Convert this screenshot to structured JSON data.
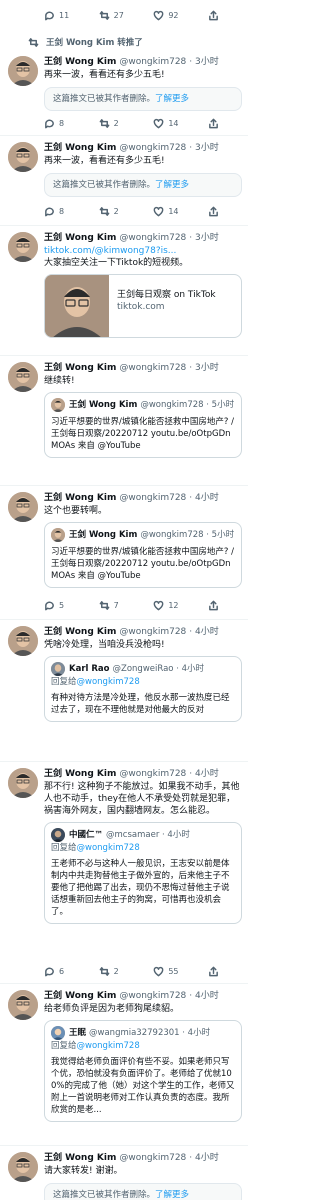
{
  "top_actions": {
    "replies": "11",
    "retweets": "27",
    "likes": "92"
  },
  "retweet_banner": "王剑 Wong Kim 转推了",
  "user": {
    "name": "王剑 Wong Kim",
    "handle": "@wongkim728"
  },
  "deleted_notice": {
    "text": "这篇推文已被其作者删除。",
    "more": "了解更多"
  },
  "tweets": [
    {
      "time": "· 3小时",
      "text": "再来一波，看看还有多少五毛!",
      "actions": {
        "replies": "8",
        "retweets": "2",
        "likes": "14"
      }
    },
    {
      "time": "· 3小时",
      "text": "再来一波，看看还有多少五毛!",
      "actions": {
        "replies": "8",
        "retweets": "2",
        "likes": "14"
      }
    },
    {
      "time": "· 3小时",
      "link": "tiktok.com/@kimwong78?is...",
      "text": "大家抽空关注一下Tiktok的短视频。",
      "card": {
        "title": "王剑每日观察 on TikTok",
        "domain": "tiktok.com"
      }
    },
    {
      "time": "· 3小时",
      "text": "继续转!",
      "quote": {
        "name": "王剑 Wong Kim",
        "handle": "@wongkim728 · 5小时",
        "text": "习近平想要的世界/城镇化能否拯救中国房地产? /王剑每日观察/20220712 youtu.be/oOtpGDnMOAs 来自 @YouTube"
      }
    },
    {
      "time": "· 4小时",
      "text": "这个也要转啊。",
      "quote": {
        "name": "王剑 Wong Kim",
        "handle": "@wongkim728 · 5小时",
        "text": "习近平想要的世界/城镇化能否拯救中国房地产? /王剑每日观察/20220712 youtu.be/oOtpGDnMOAs 来自 @YouTube"
      },
      "actions": {
        "replies": "5",
        "retweets": "7",
        "likes": "12"
      }
    },
    {
      "time": "· 4小时",
      "text": "凭啥冷处理，当咱没兵没枪吗!",
      "quote": {
        "name": "Karl Rao",
        "handle": "@ZongweiRao · 4小时",
        "reply_prefix": "回复给",
        "reply_to": "@wongkim728",
        "text": "有种对待方法是冷处理，他反水那一波热度已经过去了，现在不理他就是对他最大的反对"
      }
    },
    {
      "time": "· 4小时",
      "text": "那不行! 这种狗子不能放过。如果我不动手，其他人也不动手，they在他人不承受处罚就是犯罪，祸害海外网友，国内翻墙网友。怎么能忍。",
      "quote": {
        "name": "中國仁™",
        "handle": "@mcsamaer · 4小时",
        "reply_prefix": "回复给",
        "reply_to": "@wongkim728",
        "text": "王老师不必与这种人一般见识，王志安以前是体制内中共走狗替他主子做外宣的，后来他主子不要他了把他踢了出去，现仍不思悔过替他主子说话想重新回去他主子的狗窝，可惜再也没机会了。"
      },
      "actions": {
        "replies": "6",
        "retweets": "2",
        "likes": "55"
      }
    },
    {
      "time": "· 4小时",
      "text": "给老师负评是因为老师狗尾续貂。",
      "quote": {
        "name": "王眠",
        "handle": "@wangmia32792301 · 4小时",
        "reply_prefix": "回复给",
        "reply_to": "@wongkim728",
        "text": "我觉得给老师负面评价有些不妥。如果老师只写个优，恐怕就没有负面评价了。老师给了优就100%的完成了他（她）对这个学生的工作，老师又附上一首说明老师对工作认真负责的态度。我所欣赏的是老..."
      }
    },
    {
      "time": "· 4小时",
      "text": "请大家转发! 谢谢。"
    }
  ]
}
